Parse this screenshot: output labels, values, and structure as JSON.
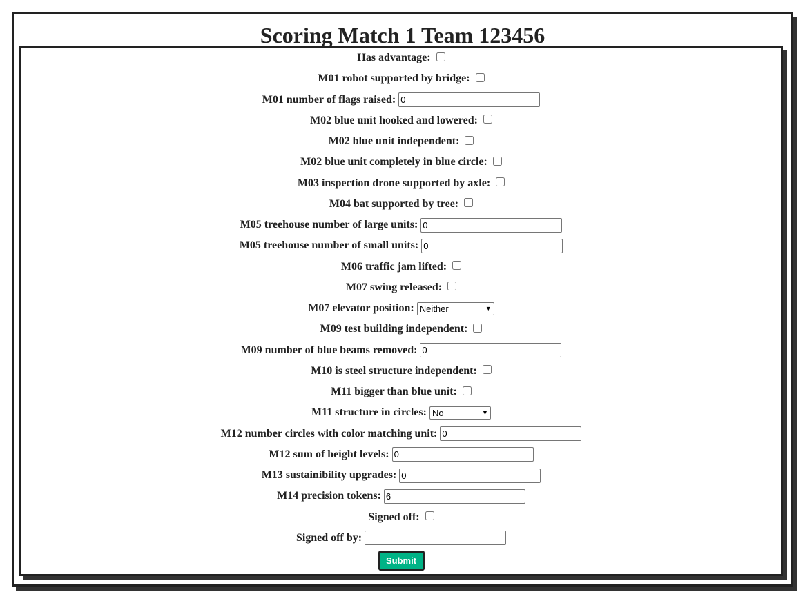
{
  "title": "Scoring Match 1 Team 123456",
  "fields": [
    {
      "label": "Has advantage:",
      "type": "checkbox",
      "checked": false
    },
    {
      "label": "M01 robot supported by bridge:",
      "type": "checkbox",
      "checked": false
    },
    {
      "label": "M01 number of flags raised:",
      "type": "text",
      "value": "0"
    },
    {
      "label": "M02 blue unit hooked and lowered:",
      "type": "checkbox",
      "checked": false
    },
    {
      "label": "M02 blue unit independent:",
      "type": "checkbox",
      "checked": false
    },
    {
      "label": "M02 blue unit completely in blue circle:",
      "type": "checkbox",
      "checked": false
    },
    {
      "label": "M03 inspection drone supported by axle:",
      "type": "checkbox",
      "checked": false
    },
    {
      "label": "M04 bat supported by tree:",
      "type": "checkbox",
      "checked": false
    },
    {
      "label": "M05 treehouse number of large units:",
      "type": "text",
      "value": "0"
    },
    {
      "label": "M05 treehouse number of small units:",
      "type": "text",
      "value": "0"
    },
    {
      "label": "M06 traffic jam lifted:",
      "type": "checkbox",
      "checked": false
    },
    {
      "label": "M07 swing released:",
      "type": "checkbox",
      "checked": false
    },
    {
      "label": "M07 elevator position:",
      "type": "select",
      "value": "Neither"
    },
    {
      "label": "M09 test building independent:",
      "type": "checkbox",
      "checked": false
    },
    {
      "label": "M09 number of blue beams removed:",
      "type": "text",
      "value": "0"
    },
    {
      "label": "M10 is steel structure independent:",
      "type": "checkbox",
      "checked": false
    },
    {
      "label": "M11 bigger than blue unit:",
      "type": "checkbox",
      "checked": false
    },
    {
      "label": "M11 structure in circles:",
      "type": "select",
      "value": "No"
    },
    {
      "label": "M12 number circles with color matching unit:",
      "type": "text",
      "value": "0"
    },
    {
      "label": "M12 sum of height levels:",
      "type": "text",
      "value": "0"
    },
    {
      "label": "M13 sustainibility upgrades:",
      "type": "text",
      "value": "0"
    },
    {
      "label": "M14 precision tokens:",
      "type": "text",
      "value": "6"
    },
    {
      "label": "Signed off:",
      "type": "checkbox",
      "checked": false
    },
    {
      "label": "Signed off by:",
      "type": "text",
      "value": ""
    }
  ],
  "submit_label": "Submit",
  "colors": {
    "submit_bg": "#00b386",
    "border": "#222222"
  }
}
